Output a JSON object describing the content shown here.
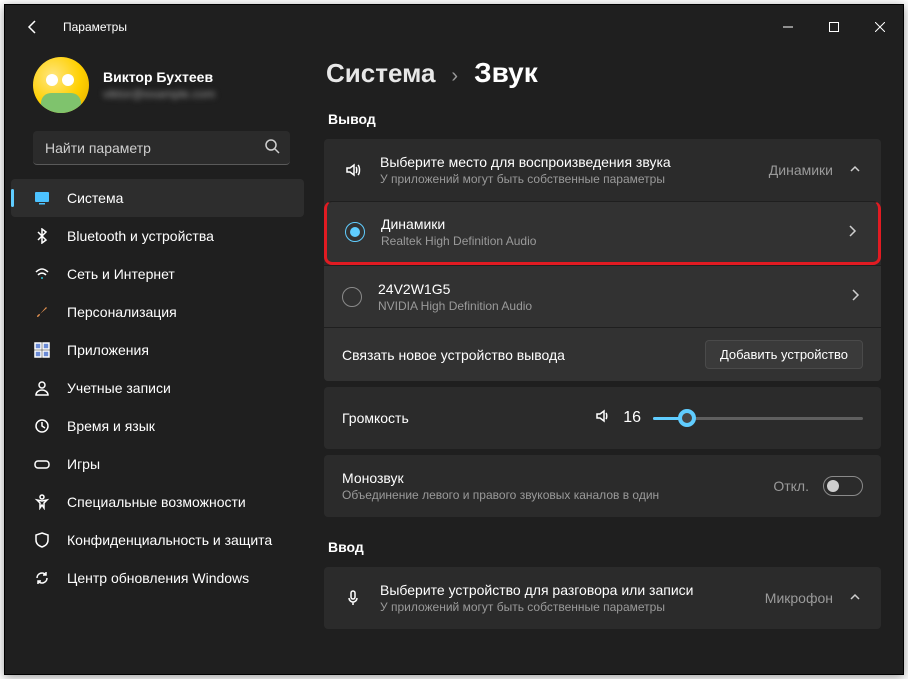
{
  "app_title": "Параметры",
  "profile": {
    "name": "Виктор Бухтеев",
    "sub": "viktor@example.com"
  },
  "search": {
    "placeholder": "Найти параметр"
  },
  "sidebar": {
    "items": [
      {
        "label": "Система"
      },
      {
        "label": "Bluetooth и устройства"
      },
      {
        "label": "Сеть и Интернет"
      },
      {
        "label": "Персонализация"
      },
      {
        "label": "Приложения"
      },
      {
        "label": "Учетные записи"
      },
      {
        "label": "Время и язык"
      },
      {
        "label": "Игры"
      },
      {
        "label": "Специальные возможности"
      },
      {
        "label": "Конфиденциальность и защита"
      },
      {
        "label": "Центр обновления Windows"
      }
    ]
  },
  "breadcrumb": {
    "parent": "Система",
    "current": "Звук"
  },
  "output": {
    "heading": "Вывод",
    "choose_title": "Выберите место для воспроизведения звука",
    "choose_sub": "У приложений могут быть собственные параметры",
    "current": "Динамики",
    "devices": [
      {
        "name": "Динамики",
        "sub": "Realtek High Definition Audio"
      },
      {
        "name": "24V2W1G5",
        "sub": "NVIDIA High Definition Audio"
      }
    ],
    "pair_label": "Связать новое устройство вывода",
    "add_btn": "Добавить устройство"
  },
  "volume": {
    "label": "Громкость",
    "value": "16"
  },
  "mono": {
    "title": "Монозвук",
    "sub": "Объединение левого и правого звуковых каналов в один",
    "state": "Откл."
  },
  "input": {
    "heading": "Ввод",
    "choose_title": "Выберите устройство для разговора или записи",
    "choose_sub": "У приложений могут быть собственные параметры",
    "current": "Микрофон"
  }
}
